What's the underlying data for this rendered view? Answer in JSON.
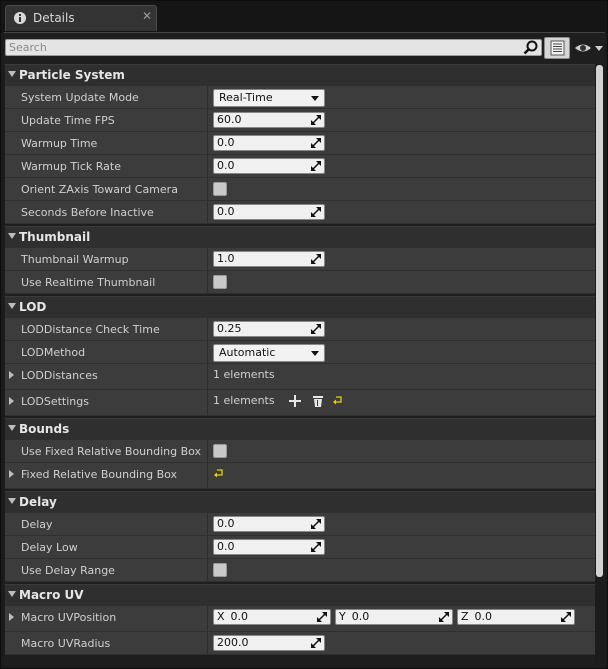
{
  "tab": {
    "label": "Details",
    "close": "✕"
  },
  "search": {
    "placeholder": "Search"
  },
  "categories": [
    {
      "title": "Particle System",
      "rows": [
        {
          "name": "System Update Mode",
          "type": "dropdown",
          "value": "Real-Time"
        },
        {
          "name": "Update Time FPS",
          "type": "number",
          "value": "60.0"
        },
        {
          "name": "Warmup Time",
          "type": "number",
          "value": "0.0"
        },
        {
          "name": "Warmup Tick Rate",
          "type": "number",
          "value": "0.0"
        },
        {
          "name": "Orient ZAxis Toward Camera",
          "type": "checkbox",
          "checked": false
        },
        {
          "name": "Seconds Before Inactive",
          "type": "number",
          "value": "0.0"
        }
      ]
    },
    {
      "title": "Thumbnail",
      "rows": [
        {
          "name": "Thumbnail Warmup",
          "type": "number",
          "value": "1.0"
        },
        {
          "name": "Use Realtime Thumbnail",
          "type": "checkbox",
          "checked": false
        }
      ]
    },
    {
      "title": "LOD",
      "rows": [
        {
          "name": "LODDistance Check Time",
          "type": "number",
          "value": "0.25"
        },
        {
          "name": "LODMethod",
          "type": "dropdown",
          "value": "Automatic"
        },
        {
          "name": "LODDistances",
          "type": "array",
          "value": "1 elements",
          "expandable": true
        },
        {
          "name": "LODSettings",
          "type": "array",
          "value": "1 elements",
          "expandable": true,
          "actions": true
        }
      ]
    },
    {
      "title": "Bounds",
      "rows": [
        {
          "name": "Use Fixed Relative Bounding Box",
          "type": "checkbox",
          "checked": false
        },
        {
          "name": "Fixed Relative Bounding Box",
          "type": "reset",
          "expandable": true
        }
      ]
    },
    {
      "title": "Delay",
      "rows": [
        {
          "name": "Delay",
          "type": "number",
          "value": "0.0"
        },
        {
          "name": "Delay Low",
          "type": "number",
          "value": "0.0"
        },
        {
          "name": "Use Delay Range",
          "type": "checkbox",
          "checked": false
        }
      ]
    },
    {
      "title": "Macro UV",
      "rows": [
        {
          "name": "Macro UVPosition",
          "type": "vector",
          "expandable": true,
          "components": [
            {
              "axis": "X",
              "value": "0.0"
            },
            {
              "axis": "Y",
              "value": "0.0"
            },
            {
              "axis": "Z",
              "value": "0.0"
            }
          ]
        },
        {
          "name": "Macro UVRadius",
          "type": "number",
          "value": "200.0"
        }
      ]
    }
  ],
  "colors": {
    "panel": "#3c3c3c",
    "header": "#2f2f2f",
    "reset_arrow": "#e8d200"
  }
}
